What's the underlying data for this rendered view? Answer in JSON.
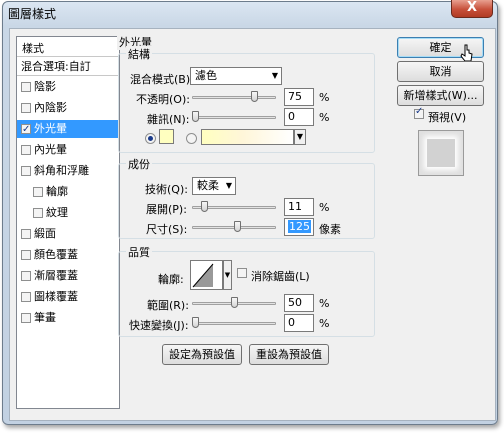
{
  "window": {
    "title": "圖層樣式",
    "close_glyph": "X"
  },
  "style_list": {
    "header": "樣式",
    "blending": "混合選項:自訂",
    "items": [
      {
        "label": "陰影",
        "checked": false,
        "selected": false
      },
      {
        "label": "內陰影",
        "checked": false,
        "selected": false
      },
      {
        "label": "外光暈",
        "checked": true,
        "selected": true
      },
      {
        "label": "內光暈",
        "checked": false,
        "selected": false
      },
      {
        "label": "斜角和浮雕",
        "checked": false,
        "selected": false
      },
      {
        "label": "輪廓",
        "checked": false,
        "selected": false
      },
      {
        "label": "紋理",
        "checked": false,
        "selected": false
      },
      {
        "label": "緞面",
        "checked": false,
        "selected": false
      },
      {
        "label": "顏色覆蓋",
        "checked": false,
        "selected": false
      },
      {
        "label": "漸層覆蓋",
        "checked": false,
        "selected": false
      },
      {
        "label": "圖樣覆蓋",
        "checked": false,
        "selected": false
      },
      {
        "label": "筆畫",
        "checked": false,
        "selected": false
      }
    ]
  },
  "outer_glow": {
    "title": "外光暈",
    "structure": {
      "title": "結構",
      "blend_mode_label": "混合模式(B):",
      "blend_mode_value": "濾色",
      "opacity_label": "不透明(O):",
      "opacity_value": "75",
      "opacity_unit": "%",
      "opacity_fraction": 0.75,
      "noise_label": "雜訊(N):",
      "noise_value": "0",
      "noise_unit": "%",
      "noise_fraction": 0,
      "glow_color": "#ffffc0"
    },
    "elements": {
      "title": "成份",
      "technique_label": "技術(Q):",
      "technique_value": "較柔",
      "spread_label": "展開(P):",
      "spread_value": "11",
      "spread_unit": "%",
      "spread_fraction": 0.11,
      "size_label": "尺寸(S):",
      "size_value": "125",
      "size_unit": "像素"
    },
    "quality": {
      "title": "品質",
      "contour_label": "輪廓:",
      "antialias_label": "消除鋸齒(L)",
      "antialias_checked": false,
      "range_label": "範圍(R):",
      "range_value": "50",
      "range_unit": "%",
      "range_fraction": 0.5,
      "jitter_label": "快速變換(J):",
      "jitter_value": "0",
      "jitter_unit": "%",
      "jitter_fraction": 0
    },
    "make_default": "設定為預設值",
    "reset_default": "重設為預設值"
  },
  "buttons": {
    "ok": "確定",
    "cancel": "取消",
    "new_style": "新增樣式(W)...",
    "preview_label": "預視(V)",
    "preview_checked": true
  }
}
